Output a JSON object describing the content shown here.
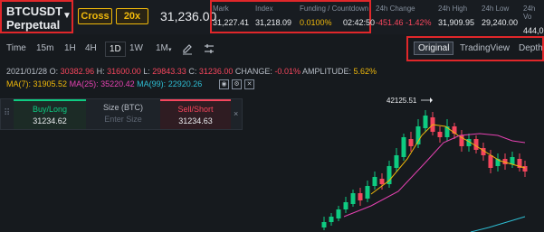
{
  "header": {
    "symbol": "BTCUSDT",
    "contract": "Perpetual",
    "margin_mode": "Cross",
    "leverage": "20x",
    "last_price": "31,236.00",
    "mark_label": "Mark",
    "mark_value": "31,227.41",
    "index_label": "Index",
    "index_value": "31,218.09",
    "funding_label": "Funding / Countdown",
    "funding_rate": "0.0100%",
    "countdown": "02:42:50",
    "change_label": "24h Change",
    "change_value": "-451.46 -1.42%",
    "high_label": "24h High",
    "high_value": "31,909.95",
    "low_label": "24h Low",
    "low_value": "29,240.00",
    "vol_label": "24h Vo",
    "vol_value": "444,0"
  },
  "toolbar": {
    "time_label": "Time",
    "intervals": [
      "15m",
      "1H",
      "4H",
      "1D",
      "1W",
      "1M"
    ],
    "active_interval": "1D",
    "views": [
      "Original",
      "TradingView",
      "Depth"
    ],
    "active_view": "Original"
  },
  "ohlc": {
    "date": "2021/01/28",
    "o_label": "O:",
    "o": "30382.96",
    "h_label": "H:",
    "h": "31600.00",
    "l_label": "L:",
    "l": "29843.33",
    "c_label": "C:",
    "c": "31236.00",
    "change_label": "CHANGE:",
    "change": "-0.01%",
    "amplitude_label": "AMPLITUDE:",
    "amplitude": "5.62%"
  },
  "ma": {
    "ma7_label": "MA(7):",
    "ma7": "31905.52",
    "ma25_label": "MA(25):",
    "ma25": "35220.42",
    "ma99_label": "MA(99):",
    "ma99": "22920.26"
  },
  "order_widget": {
    "buy_label": "Buy/Long",
    "buy_price": "31234.62",
    "size_label": "Size (BTC)",
    "size_placeholder": "Enter Size",
    "sell_label": "Sell/Short",
    "sell_price": "31234.63",
    "close_glyph": "×",
    "drag_glyph": "⠿"
  },
  "chart": {
    "high_marker": "42125.51",
    "up_color": "#0ecb81",
    "down_color": "#f6465d",
    "ma7_color": "#f0b90b",
    "ma25_color": "#e642b2",
    "ma99_color": "#2ebdd3"
  },
  "colors": {
    "accent": "#f0b90b",
    "highlight_box": "#e0272a",
    "background": "#161a1e"
  }
}
